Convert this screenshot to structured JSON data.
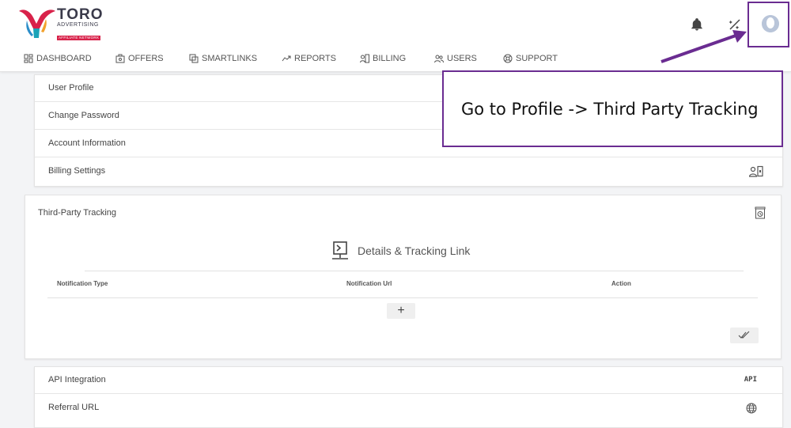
{
  "brand": {
    "name": "TORO",
    "sub": "ADVERTISING",
    "badge": "AFFILIATE NETWORK"
  },
  "nav": {
    "items": [
      {
        "label": "DASHBOARD",
        "icon": "dashboard-icon"
      },
      {
        "label": "OFFERS",
        "icon": "offers-icon"
      },
      {
        "label": "SMARTLINKS",
        "icon": "smartlinks-icon"
      },
      {
        "label": "REPORTS",
        "icon": "reports-icon"
      },
      {
        "label": "BILLING",
        "icon": "billing-icon"
      },
      {
        "label": "USERS",
        "icon": "users-icon"
      },
      {
        "label": "SUPPORT",
        "icon": "support-icon"
      }
    ]
  },
  "header_icons": [
    "bell-icon",
    "magic-wand-icon",
    "avatar-icon"
  ],
  "profile_menu": {
    "items": [
      {
        "label": "User Profile"
      },
      {
        "label": "Change Password"
      },
      {
        "label": "Account Information"
      },
      {
        "label": "Billing Settings",
        "icon": "billing-settings-icon"
      }
    ]
  },
  "callout": {
    "text": "Go to Profile -> Third Party Tracking"
  },
  "third_party": {
    "title": "Third-Party Tracking",
    "section_title": "Details & Tracking Link",
    "columns": [
      "Notification Type",
      "Notification Url",
      "Action"
    ],
    "add_label": "+"
  },
  "bottom_menu": {
    "items": [
      {
        "label": "API Integration",
        "icon_text": "API"
      },
      {
        "label": "Referral URL",
        "icon": "globe-icon"
      }
    ]
  },
  "colors": {
    "accent": "#6a2c91",
    "brand_red": "#d8224a",
    "brand_teal": "#1aa3b8"
  }
}
